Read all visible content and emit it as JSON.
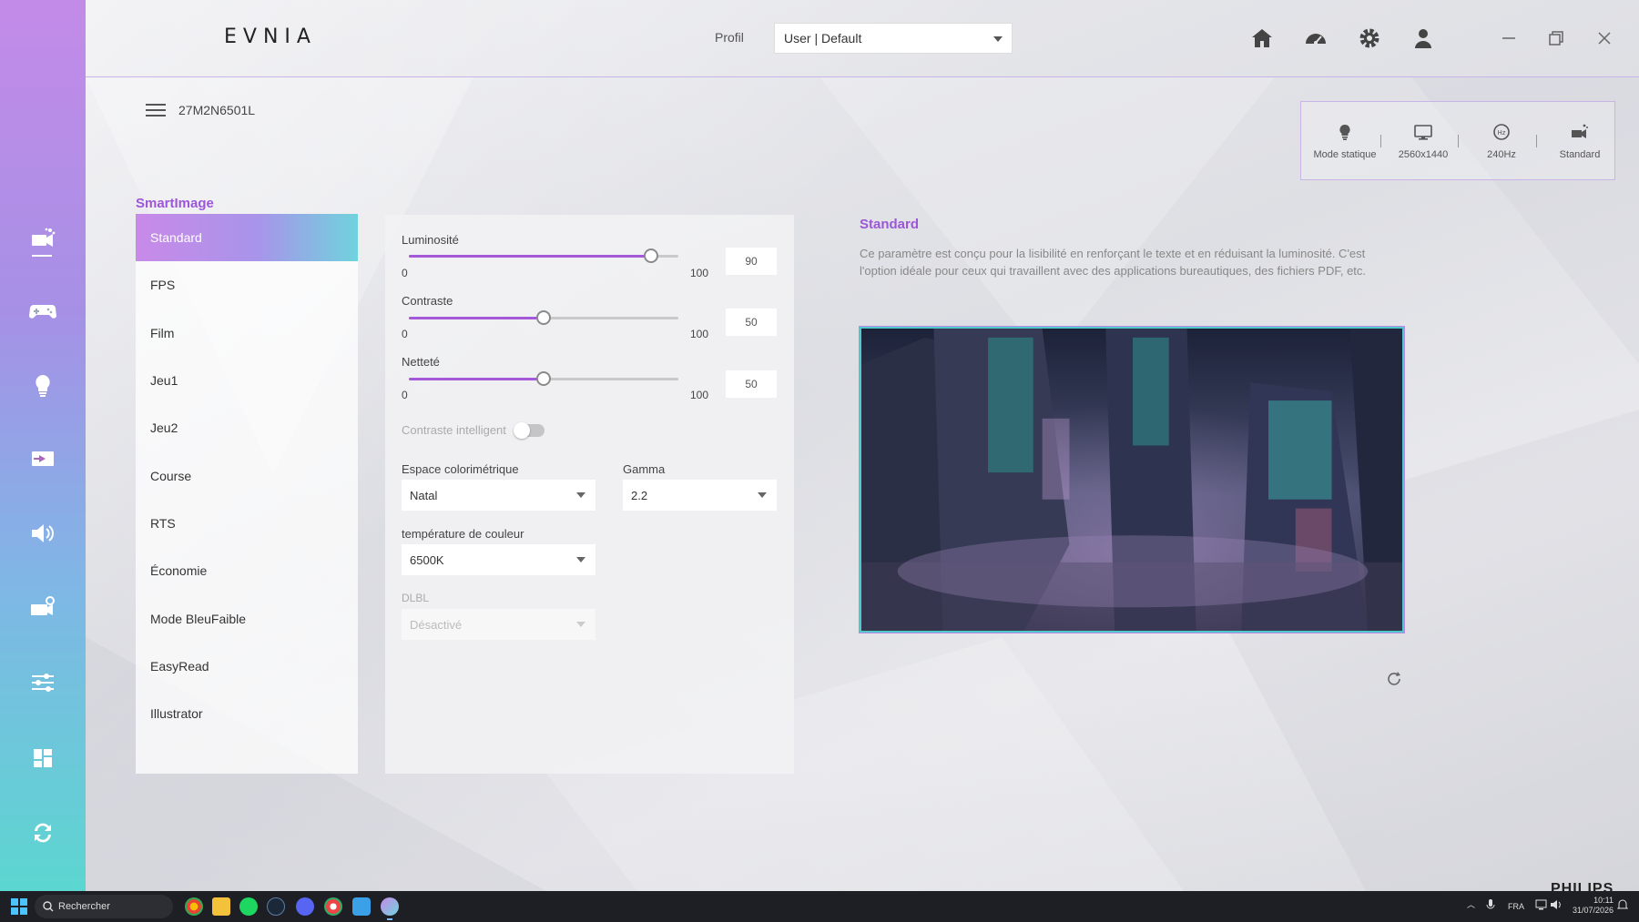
{
  "app": {
    "logo": "EVNIA",
    "brand_watermark": "PHILIPS"
  },
  "header": {
    "profil_label": "Profil",
    "profil_value": "User | Default",
    "icons": [
      "home-icon",
      "speedometer-icon",
      "gear-icon",
      "user-icon"
    ],
    "window_controls": [
      "minimize-icon",
      "restore-icon",
      "close-icon"
    ]
  },
  "sidebar": {
    "items": [
      {
        "icon": "smartimage-icon",
        "active": true
      },
      {
        "icon": "gamepad-icon",
        "active": false
      },
      {
        "icon": "lightbulb-icon",
        "active": false
      },
      {
        "icon": "input-icon",
        "active": false
      },
      {
        "icon": "speaker-icon",
        "active": false
      },
      {
        "icon": "monitor-settings-icon",
        "active": false
      },
      {
        "icon": "sliders-icon",
        "active": false
      },
      {
        "icon": "dashboard-icon",
        "active": false
      },
      {
        "icon": "sync-icon",
        "active": false
      }
    ]
  },
  "device": {
    "name": "27M2N6501L"
  },
  "status": {
    "items": [
      {
        "icon": "lightbulb-icon",
        "label": "Mode statique"
      },
      {
        "icon": "monitor-icon",
        "label": "2560x1440"
      },
      {
        "icon": "hz-icon",
        "label": "240Hz"
      },
      {
        "icon": "smartimage-icon",
        "label": "Standard"
      }
    ]
  },
  "smartimage": {
    "title": "SmartImage",
    "items": [
      "Standard",
      "FPS",
      "Film",
      "Jeu1",
      "Jeu2",
      "Course",
      "RTS",
      "Économie",
      "Mode BleuFaible",
      "EasyRead",
      "Illustrator"
    ],
    "active_index": 0
  },
  "settings": {
    "brightness": {
      "label": "Luminosité",
      "min": "0",
      "max": "100",
      "value": "90",
      "level": 90
    },
    "contrast": {
      "label": "Contraste",
      "min": "0",
      "max": "100",
      "value": "50",
      "level": 50
    },
    "sharpness": {
      "label": "Netteté",
      "min": "0",
      "max": "100",
      "value": "50",
      "level": 50
    },
    "smart_contrast": {
      "label": "Contraste intelligent",
      "on": false
    },
    "color_space": {
      "label": "Espace colorimétrique",
      "value": "Natal"
    },
    "gamma": {
      "label": "Gamma",
      "value": "2.2"
    },
    "color_temp": {
      "label": "température de couleur",
      "value": "6500K"
    },
    "dlbl": {
      "label": "DLBL",
      "value": "Désactivé",
      "disabled": true
    }
  },
  "description": {
    "title": "Standard",
    "text": "Ce paramètre est conçu pour la lisibilité en renforçant le texte et en réduisant la luminosité. C'est l'option idéale pour ceux qui travaillent avec des applications bureautiques, des fichiers PDF, etc."
  },
  "taskbar": {
    "search_placeholder": "Rechercher",
    "lang": "FRA",
    "time": "10:11",
    "date": "31/07/2026"
  },
  "colors": {
    "accent": "#9b57d8",
    "accent_teal": "#4fc9c9",
    "slider_fill": "#a45ad8"
  }
}
